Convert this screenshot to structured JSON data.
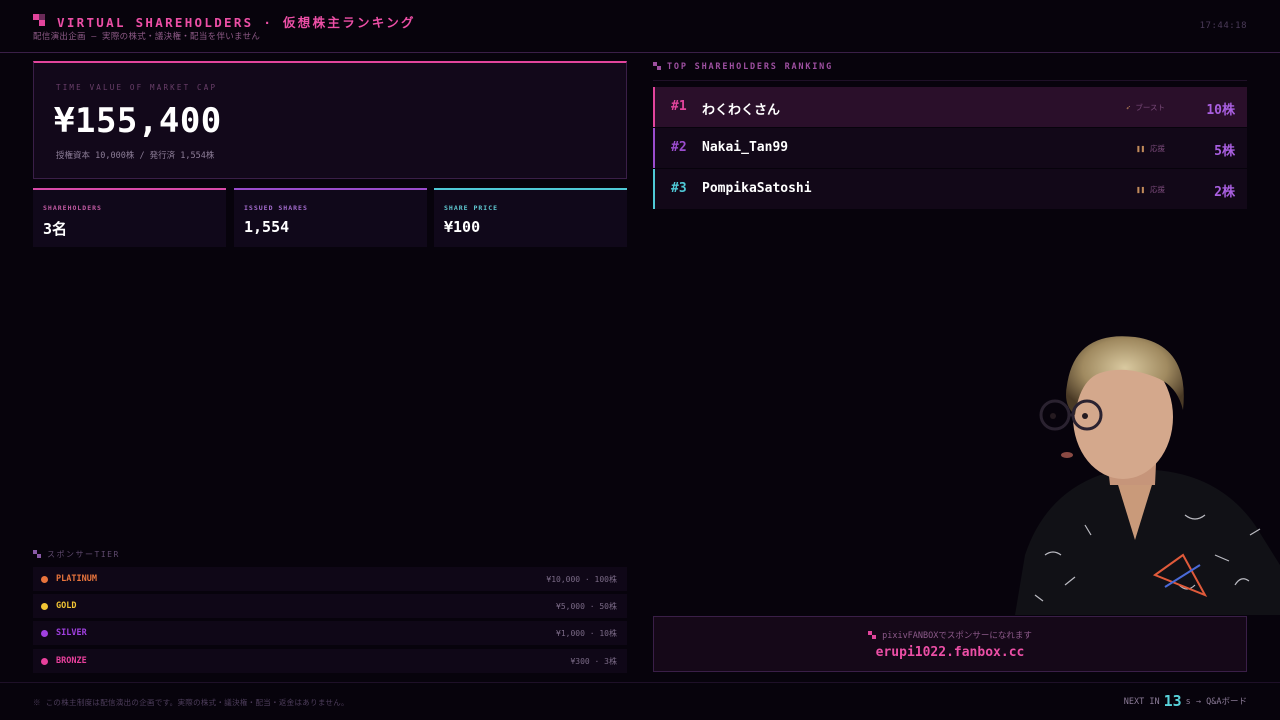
{
  "header": {
    "title": "VIRTUAL SHAREHOLDERS · 仮想株主ランキング",
    "subtitle": "配信演出企画 — 実際の株式・議決権・配当を伴いません",
    "clock": "17:44:18"
  },
  "market_cap": {
    "label": "TIME VALUE OF MARKET CAP",
    "value": "¥155,400",
    "detail": "授権資本 10,000株 / 発行済 1,554株"
  },
  "stats": [
    {
      "label": "SHAREHOLDERS",
      "value": "3名"
    },
    {
      "label": "ISSUED SHARES",
      "value": "1,554"
    },
    {
      "label": "SHARE PRICE",
      "value": "¥100"
    }
  ],
  "sponsor_tier": {
    "heading": "スポンサーTIER",
    "tiers": [
      {
        "name": "PLATINUM",
        "price": "¥10,000 · 100株",
        "color": "#e8743c"
      },
      {
        "name": "GOLD",
        "price": "¥5,000 · 50株",
        "color": "#f2c534"
      },
      {
        "name": "SILVER",
        "price": "¥1,000 · 10株",
        "color": "#a040e0"
      },
      {
        "name": "BRONZE",
        "price": "¥300 · 3株",
        "color": "#e8409c"
      }
    ]
  },
  "ranking": {
    "heading": "TOP SHAREHOLDERS RANKING",
    "rows": [
      {
        "rank": "#1",
        "name": "わくわくさん",
        "badge_icon": "rocket-icon",
        "badge": "ブースト",
        "shares": "10株",
        "color": "#e2449c"
      },
      {
        "rank": "#2",
        "name": "Nakai_Tan99",
        "badge_icon": "pause-icon",
        "badge": "応援",
        "shares": "5株",
        "color": "#9a4ccd"
      },
      {
        "rank": "#3",
        "name": "PompikaSatoshi",
        "badge_icon": "pause-icon",
        "badge": "応援",
        "shares": "2株",
        "color": "#4fc9d6"
      }
    ]
  },
  "fanbox": {
    "label": "pixivFANBOXでスポンサーになれます",
    "url": "erupi1022.fanbox.cc"
  },
  "footer": {
    "note": "※ この株主制度は配信演出の企画です。実際の株式・議決権・配当・返金はありません。",
    "next_prefix": "NEXT IN",
    "next_count": "13",
    "next_suffix": "s → Q&Aボード"
  }
}
